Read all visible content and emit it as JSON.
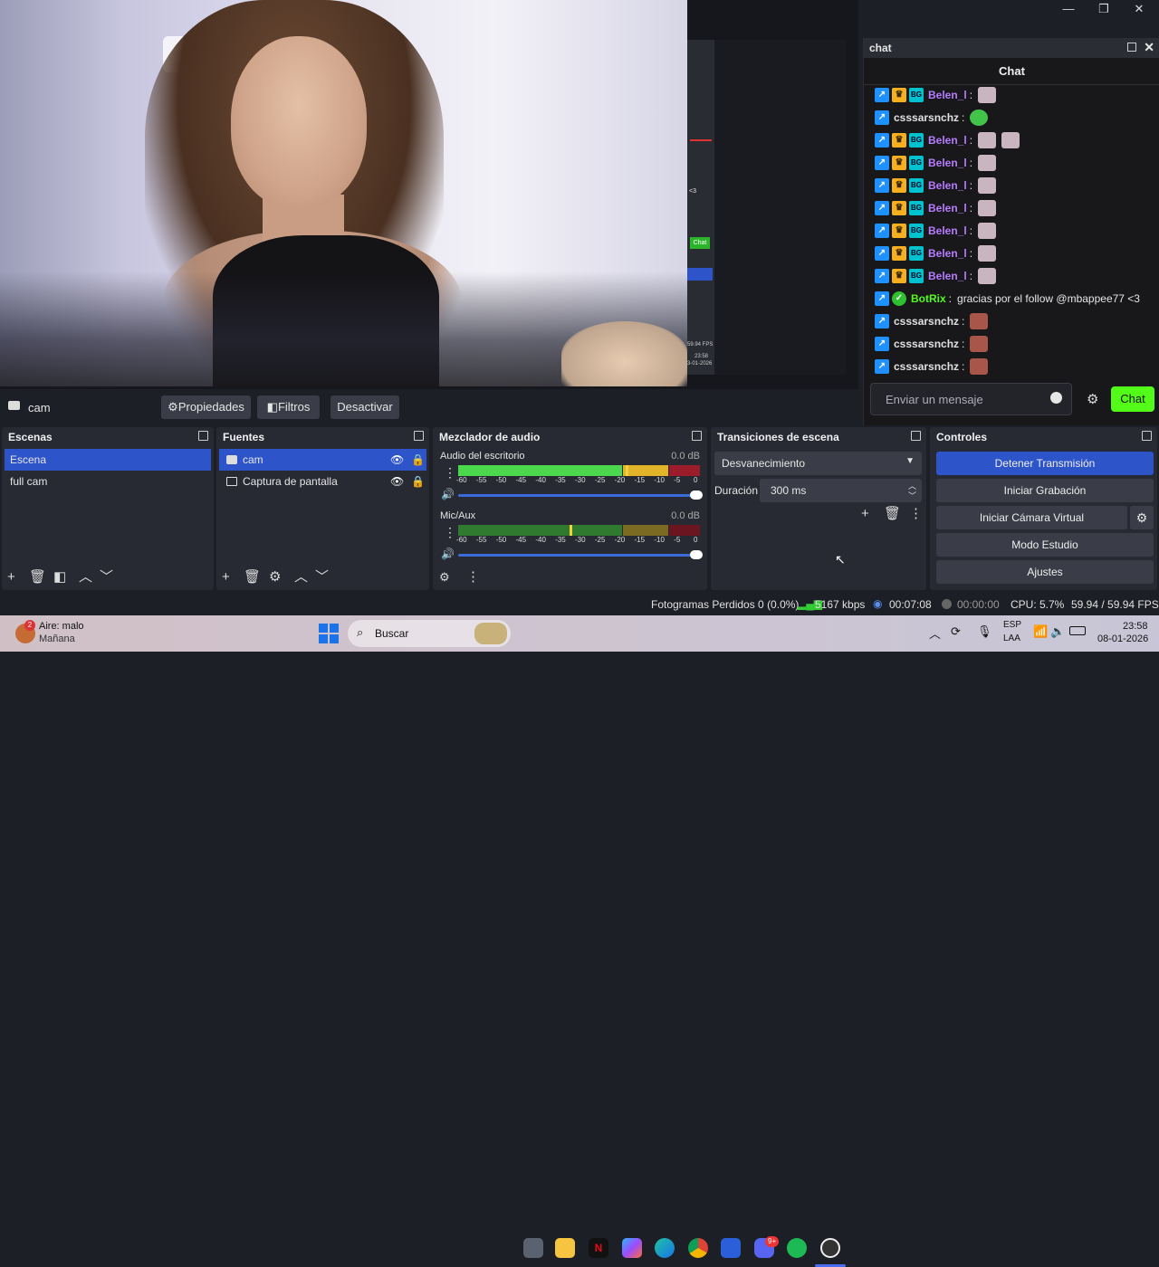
{
  "window": {
    "minimize_glyph": "—",
    "maximize_glyph": "❐",
    "close_glyph": "✕"
  },
  "preview": {
    "strip_chat_label": "Chat",
    "strip_fps": "59.94 FPS",
    "strip_time": "23:58",
    "strip_date": "3-01-2026",
    "strip_heart": "<3"
  },
  "chat": {
    "dock_title": "chat",
    "header": "Chat",
    "messages": [
      {
        "user": "Belen_l",
        "color": "#b77cff",
        "badges": [
          "blue",
          "gold",
          "teal"
        ],
        "text": "",
        "emotes": 1
      },
      {
        "user": "csssarsnchz",
        "color": "#e0e0e0",
        "badges": [
          "blue"
        ],
        "text": "",
        "emotes": 1,
        "emote_type": "green"
      },
      {
        "user": "Belen_l",
        "color": "#b77cff",
        "badges": [
          "blue",
          "gold",
          "teal"
        ],
        "text": "",
        "emotes": 2
      },
      {
        "user": "Belen_l",
        "color": "#b77cff",
        "badges": [
          "blue",
          "gold",
          "teal"
        ],
        "text": "",
        "emotes": 1
      },
      {
        "user": "Belen_l",
        "color": "#b77cff",
        "badges": [
          "blue",
          "gold",
          "teal"
        ],
        "text": "",
        "emotes": 1
      },
      {
        "user": "Belen_l",
        "color": "#b77cff",
        "badges": [
          "blue",
          "gold",
          "teal"
        ],
        "text": "",
        "emotes": 1
      },
      {
        "user": "Belen_l",
        "color": "#b77cff",
        "badges": [
          "blue",
          "gold",
          "teal"
        ],
        "text": "",
        "emotes": 1
      },
      {
        "user": "Belen_l",
        "color": "#b77cff",
        "badges": [
          "blue",
          "gold",
          "teal"
        ],
        "text": "",
        "emotes": 1
      },
      {
        "user": "Belen_l",
        "color": "#b77cff",
        "badges": [
          "blue",
          "gold",
          "teal"
        ],
        "text": "",
        "emotes": 1
      },
      {
        "user": "BotRix",
        "color": "#53fc18",
        "badges": [
          "blue",
          "green"
        ],
        "text": "gracias por el follow @mbappee77 <3",
        "emotes": 0
      },
      {
        "user": "csssarsnchz",
        "color": "#e0e0e0",
        "badges": [
          "blue"
        ],
        "text": "",
        "emotes": 1,
        "emote_type": "face"
      },
      {
        "user": "csssarsnchz",
        "color": "#e0e0e0",
        "badges": [
          "blue"
        ],
        "text": "",
        "emotes": 1,
        "emote_type": "face"
      },
      {
        "user": "csssarsnchz",
        "color": "#e0e0e0",
        "badges": [
          "blue"
        ],
        "text": "",
        "emotes": 1,
        "emote_type": "face"
      }
    ],
    "input_placeholder": "Enviar un mensaje",
    "send_label": "Chat"
  },
  "sourcebar": {
    "source_name": "cam",
    "properties": "Propiedades",
    "filters": "Filtros",
    "deactivate": "Desactivar"
  },
  "scenes": {
    "title": "Escenas",
    "items": [
      "Escena",
      "full cam"
    ],
    "selected": 0
  },
  "sources": {
    "title": "Fuentes",
    "items": [
      "cam",
      "Captura de pantalla"
    ],
    "selected": 0
  },
  "mixer": {
    "title": "Mezclador de audio",
    "channels": [
      {
        "name": "Audio del escritorio",
        "db": "0.0 dB",
        "level": 0.69
      },
      {
        "name": "Mic/Aux",
        "db": "0.0 dB",
        "level": 0.46
      }
    ],
    "scale": [
      "-60",
      "-55",
      "-50",
      "-45",
      "-40",
      "-35",
      "-30",
      "-25",
      "-20",
      "-15",
      "-10",
      "-5",
      "0"
    ]
  },
  "transitions": {
    "title": "Transiciones de escena",
    "selected": "Desvanecimiento",
    "duration_label": "Duración",
    "duration_value": "300 ms"
  },
  "controls": {
    "title": "Controles",
    "buttons": [
      "Detener Transmisión",
      "Iniciar Grabación",
      "Iniciar Cámara Virtual",
      "Modo Estudio",
      "Ajustes"
    ]
  },
  "status": {
    "dropped": "Fotogramas Perdidos 0 (0.0%)",
    "kbps": "5167 kbps",
    "stream_time": "00:07:08",
    "rec_time": "00:00:00",
    "cpu": "CPU: 5.7%",
    "fps": "59.94 / 59.94 FPS"
  },
  "taskbar": {
    "weather_title": "Aire: malo",
    "weather_sub": "Mañana",
    "weather_badge": "2",
    "search": "Buscar",
    "lang1": "ESP",
    "lang2": "LAA",
    "time": "23:58",
    "date": "08-01-2026",
    "discord_badge": "9+"
  }
}
